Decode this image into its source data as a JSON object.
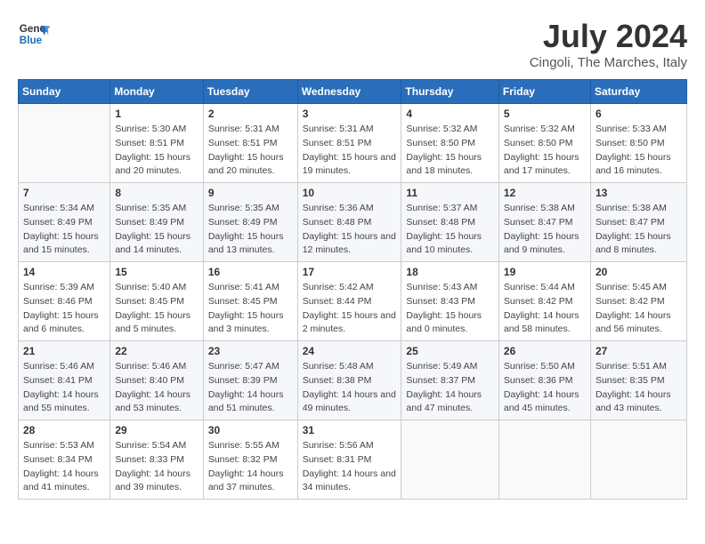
{
  "header": {
    "logo_line1": "General",
    "logo_line2": "Blue",
    "month": "July 2024",
    "location": "Cingoli, The Marches, Italy"
  },
  "columns": [
    "Sunday",
    "Monday",
    "Tuesday",
    "Wednesday",
    "Thursday",
    "Friday",
    "Saturday"
  ],
  "weeks": [
    [
      {
        "day": "",
        "sunrise": "",
        "sunset": "",
        "daylight": ""
      },
      {
        "day": "1",
        "sunrise": "Sunrise: 5:30 AM",
        "sunset": "Sunset: 8:51 PM",
        "daylight": "Daylight: 15 hours and 20 minutes."
      },
      {
        "day": "2",
        "sunrise": "Sunrise: 5:31 AM",
        "sunset": "Sunset: 8:51 PM",
        "daylight": "Daylight: 15 hours and 20 minutes."
      },
      {
        "day": "3",
        "sunrise": "Sunrise: 5:31 AM",
        "sunset": "Sunset: 8:51 PM",
        "daylight": "Daylight: 15 hours and 19 minutes."
      },
      {
        "day": "4",
        "sunrise": "Sunrise: 5:32 AM",
        "sunset": "Sunset: 8:50 PM",
        "daylight": "Daylight: 15 hours and 18 minutes."
      },
      {
        "day": "5",
        "sunrise": "Sunrise: 5:32 AM",
        "sunset": "Sunset: 8:50 PM",
        "daylight": "Daylight: 15 hours and 17 minutes."
      },
      {
        "day": "6",
        "sunrise": "Sunrise: 5:33 AM",
        "sunset": "Sunset: 8:50 PM",
        "daylight": "Daylight: 15 hours and 16 minutes."
      }
    ],
    [
      {
        "day": "7",
        "sunrise": "Sunrise: 5:34 AM",
        "sunset": "Sunset: 8:49 PM",
        "daylight": "Daylight: 15 hours and 15 minutes."
      },
      {
        "day": "8",
        "sunrise": "Sunrise: 5:35 AM",
        "sunset": "Sunset: 8:49 PM",
        "daylight": "Daylight: 15 hours and 14 minutes."
      },
      {
        "day": "9",
        "sunrise": "Sunrise: 5:35 AM",
        "sunset": "Sunset: 8:49 PM",
        "daylight": "Daylight: 15 hours and 13 minutes."
      },
      {
        "day": "10",
        "sunrise": "Sunrise: 5:36 AM",
        "sunset": "Sunset: 8:48 PM",
        "daylight": "Daylight: 15 hours and 12 minutes."
      },
      {
        "day": "11",
        "sunrise": "Sunrise: 5:37 AM",
        "sunset": "Sunset: 8:48 PM",
        "daylight": "Daylight: 15 hours and 10 minutes."
      },
      {
        "day": "12",
        "sunrise": "Sunrise: 5:38 AM",
        "sunset": "Sunset: 8:47 PM",
        "daylight": "Daylight: 15 hours and 9 minutes."
      },
      {
        "day": "13",
        "sunrise": "Sunrise: 5:38 AM",
        "sunset": "Sunset: 8:47 PM",
        "daylight": "Daylight: 15 hours and 8 minutes."
      }
    ],
    [
      {
        "day": "14",
        "sunrise": "Sunrise: 5:39 AM",
        "sunset": "Sunset: 8:46 PM",
        "daylight": "Daylight: 15 hours and 6 minutes."
      },
      {
        "day": "15",
        "sunrise": "Sunrise: 5:40 AM",
        "sunset": "Sunset: 8:45 PM",
        "daylight": "Daylight: 15 hours and 5 minutes."
      },
      {
        "day": "16",
        "sunrise": "Sunrise: 5:41 AM",
        "sunset": "Sunset: 8:45 PM",
        "daylight": "Daylight: 15 hours and 3 minutes."
      },
      {
        "day": "17",
        "sunrise": "Sunrise: 5:42 AM",
        "sunset": "Sunset: 8:44 PM",
        "daylight": "Daylight: 15 hours and 2 minutes."
      },
      {
        "day": "18",
        "sunrise": "Sunrise: 5:43 AM",
        "sunset": "Sunset: 8:43 PM",
        "daylight": "Daylight: 15 hours and 0 minutes."
      },
      {
        "day": "19",
        "sunrise": "Sunrise: 5:44 AM",
        "sunset": "Sunset: 8:42 PM",
        "daylight": "Daylight: 14 hours and 58 minutes."
      },
      {
        "day": "20",
        "sunrise": "Sunrise: 5:45 AM",
        "sunset": "Sunset: 8:42 PM",
        "daylight": "Daylight: 14 hours and 56 minutes."
      }
    ],
    [
      {
        "day": "21",
        "sunrise": "Sunrise: 5:46 AM",
        "sunset": "Sunset: 8:41 PM",
        "daylight": "Daylight: 14 hours and 55 minutes."
      },
      {
        "day": "22",
        "sunrise": "Sunrise: 5:46 AM",
        "sunset": "Sunset: 8:40 PM",
        "daylight": "Daylight: 14 hours and 53 minutes."
      },
      {
        "day": "23",
        "sunrise": "Sunrise: 5:47 AM",
        "sunset": "Sunset: 8:39 PM",
        "daylight": "Daylight: 14 hours and 51 minutes."
      },
      {
        "day": "24",
        "sunrise": "Sunrise: 5:48 AM",
        "sunset": "Sunset: 8:38 PM",
        "daylight": "Daylight: 14 hours and 49 minutes."
      },
      {
        "day": "25",
        "sunrise": "Sunrise: 5:49 AM",
        "sunset": "Sunset: 8:37 PM",
        "daylight": "Daylight: 14 hours and 47 minutes."
      },
      {
        "day": "26",
        "sunrise": "Sunrise: 5:50 AM",
        "sunset": "Sunset: 8:36 PM",
        "daylight": "Daylight: 14 hours and 45 minutes."
      },
      {
        "day": "27",
        "sunrise": "Sunrise: 5:51 AM",
        "sunset": "Sunset: 8:35 PM",
        "daylight": "Daylight: 14 hours and 43 minutes."
      }
    ],
    [
      {
        "day": "28",
        "sunrise": "Sunrise: 5:53 AM",
        "sunset": "Sunset: 8:34 PM",
        "daylight": "Daylight: 14 hours and 41 minutes."
      },
      {
        "day": "29",
        "sunrise": "Sunrise: 5:54 AM",
        "sunset": "Sunset: 8:33 PM",
        "daylight": "Daylight: 14 hours and 39 minutes."
      },
      {
        "day": "30",
        "sunrise": "Sunrise: 5:55 AM",
        "sunset": "Sunset: 8:32 PM",
        "daylight": "Daylight: 14 hours and 37 minutes."
      },
      {
        "day": "31",
        "sunrise": "Sunrise: 5:56 AM",
        "sunset": "Sunset: 8:31 PM",
        "daylight": "Daylight: 14 hours and 34 minutes."
      },
      {
        "day": "",
        "sunrise": "",
        "sunset": "",
        "daylight": ""
      },
      {
        "day": "",
        "sunrise": "",
        "sunset": "",
        "daylight": ""
      },
      {
        "day": "",
        "sunrise": "",
        "sunset": "",
        "daylight": ""
      }
    ]
  ]
}
